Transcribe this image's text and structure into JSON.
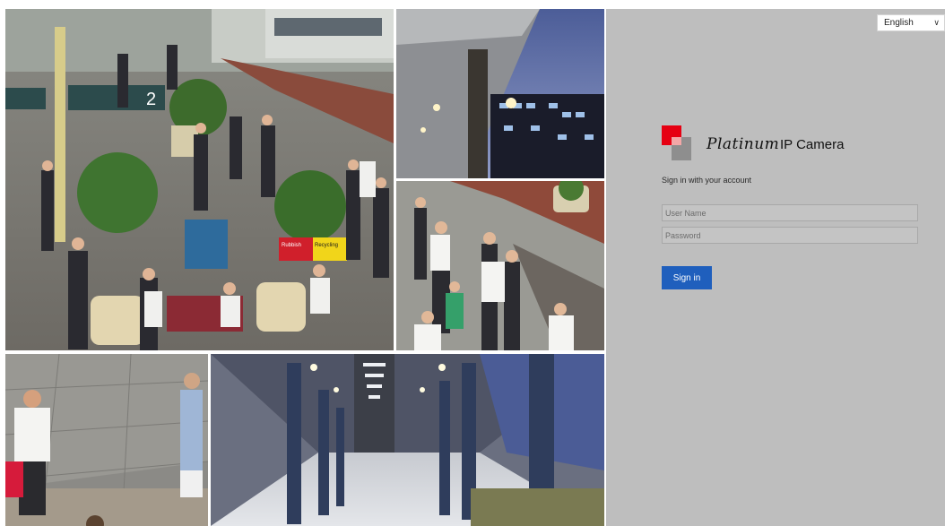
{
  "language": {
    "selected": "English",
    "chevron_icon": "chevron-down-icon"
  },
  "brand": {
    "script_text": "Platinum",
    "product_name": "IP Camera",
    "logo_colors": {
      "red": "#e60012",
      "gray": "#8e8e8e",
      "pink": "#f2a7a7"
    }
  },
  "login": {
    "subtitle": "Sign in with your account",
    "username_placeholder": "User Name",
    "password_placeholder": "Password",
    "signin_label": "Sign in",
    "signin_color": "#1f5fbd"
  },
  "preview": {
    "sign_text": "2",
    "rubbish_label": "Rubbish",
    "recycling_label": "Recycling"
  },
  "colors": {
    "panel_background": "#bebebe"
  }
}
